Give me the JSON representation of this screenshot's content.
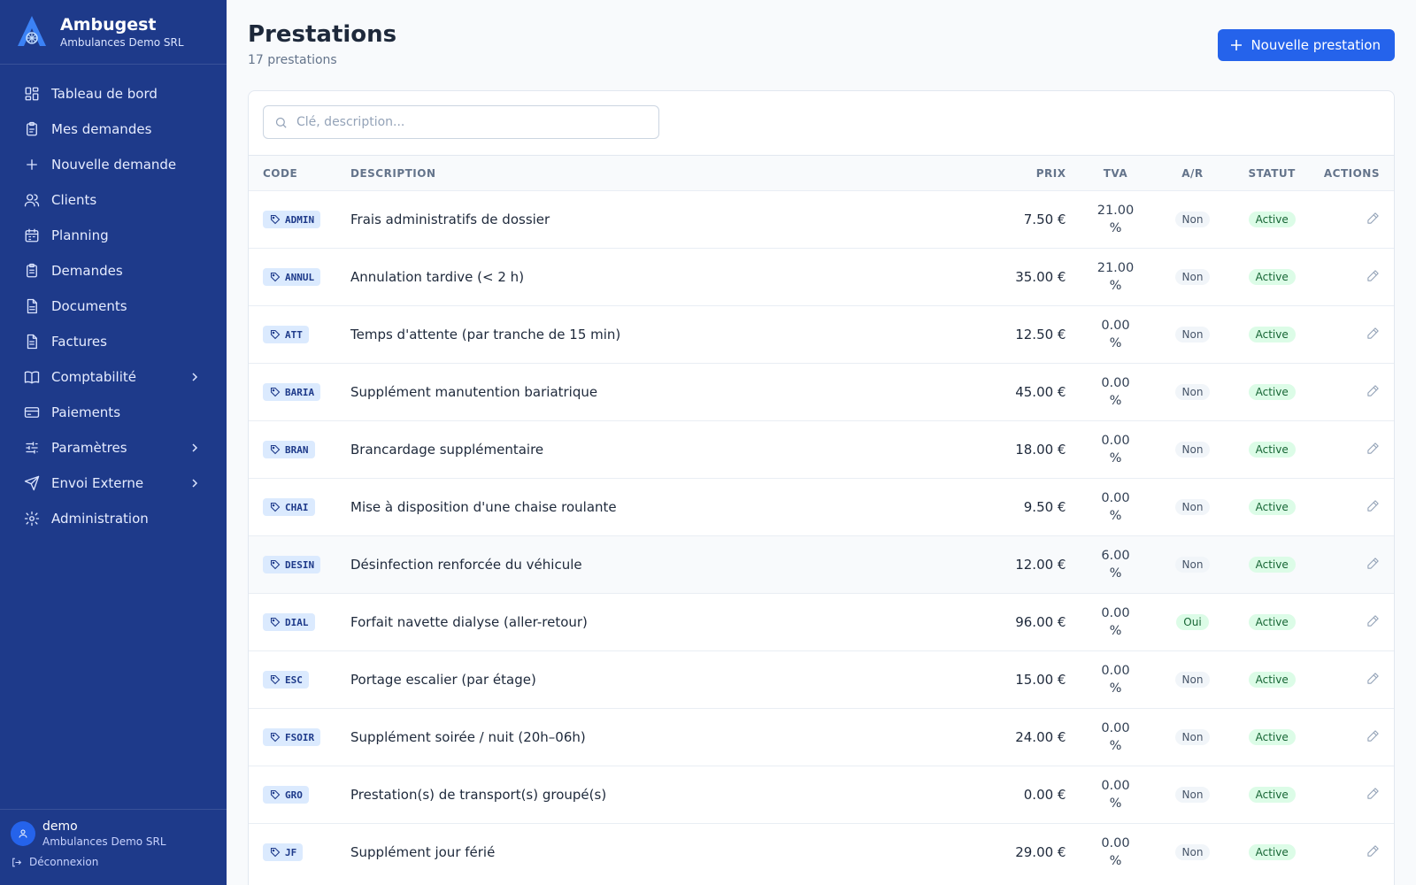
{
  "brand": {
    "name": "Ambugest",
    "subtitle": "Ambulances Demo SRL"
  },
  "nav": [
    {
      "label": "Tableau de bord",
      "icon": "dashboard-icon",
      "chevron": false
    },
    {
      "label": "Mes demandes",
      "icon": "clipboard-icon",
      "chevron": false
    },
    {
      "label": "Nouvelle demande",
      "icon": "plus-icon",
      "chevron": false
    },
    {
      "label": "Clients",
      "icon": "users-icon",
      "chevron": false
    },
    {
      "label": "Planning",
      "icon": "calendar-icon",
      "chevron": false
    },
    {
      "label": "Demandes",
      "icon": "clipboard-list-icon",
      "chevron": false
    },
    {
      "label": "Documents",
      "icon": "file-icon",
      "chevron": false
    },
    {
      "label": "Factures",
      "icon": "invoice-icon",
      "chevron": false
    },
    {
      "label": "Comptabilité",
      "icon": "book-icon",
      "chevron": true
    },
    {
      "label": "Paiements",
      "icon": "credit-card-icon",
      "chevron": false
    },
    {
      "label": "Paramètres",
      "icon": "sliders-icon",
      "chevron": true
    },
    {
      "label": "Envoi Externe",
      "icon": "send-icon",
      "chevron": true
    },
    {
      "label": "Administration",
      "icon": "gear-icon",
      "chevron": false
    }
  ],
  "user": {
    "name": "demo",
    "org": "Ambulances Demo SRL",
    "logout_label": "Déconnexion"
  },
  "page": {
    "title": "Prestations",
    "count": "17 prestations",
    "new_button": "Nouvelle prestation"
  },
  "search": {
    "placeholder": "Clé, description..."
  },
  "table": {
    "columns": {
      "code": "Code",
      "description": "Description",
      "prix": "Prix",
      "tva": "TVA",
      "ar": "A/R",
      "statut": "Statut",
      "actions": "Actions"
    },
    "rows": [
      {
        "code": "ADMIN",
        "description": "Frais administratifs de dossier",
        "prix": "7.50 €",
        "tva_value": "21.00",
        "tva_unit": "%",
        "ar": "Non",
        "statut": "Active"
      },
      {
        "code": "ANNUL",
        "description": "Annulation tardive (< 2 h)",
        "prix": "35.00 €",
        "tva_value": "21.00",
        "tva_unit": "%",
        "ar": "Non",
        "statut": "Active"
      },
      {
        "code": "ATT",
        "description": "Temps d'attente (par tranche de 15 min)",
        "prix": "12.50 €",
        "tva_value": "0.00",
        "tva_unit": "%",
        "ar": "Non",
        "statut": "Active"
      },
      {
        "code": "BARIA",
        "description": "Supplément manutention bariatrique",
        "prix": "45.00 €",
        "tva_value": "0.00",
        "tva_unit": "%",
        "ar": "Non",
        "statut": "Active"
      },
      {
        "code": "BRAN",
        "description": "Brancardage supplémentaire",
        "prix": "18.00 €",
        "tva_value": "0.00",
        "tva_unit": "%",
        "ar": "Non",
        "statut": "Active"
      },
      {
        "code": "CHAI",
        "description": "Mise à disposition d'une chaise roulante",
        "prix": "9.50 €",
        "tva_value": "0.00",
        "tva_unit": "%",
        "ar": "Non",
        "statut": "Active"
      },
      {
        "code": "DESIN",
        "description": "Désinfection renforcée du véhicule",
        "prix": "12.00 €",
        "tva_value": "6.00",
        "tva_unit": "%",
        "ar": "Non",
        "statut": "Active"
      },
      {
        "code": "DIAL",
        "description": "Forfait navette dialyse (aller-retour)",
        "prix": "96.00 €",
        "tva_value": "0.00",
        "tva_unit": "%",
        "ar": "Oui",
        "statut": "Active"
      },
      {
        "code": "ESC",
        "description": "Portage escalier (par étage)",
        "prix": "15.00 €",
        "tva_value": "0.00",
        "tva_unit": "%",
        "ar": "Non",
        "statut": "Active"
      },
      {
        "code": "FSOIR",
        "description": "Supplément soirée / nuit (20h–06h)",
        "prix": "24.00 €",
        "tva_value": "0.00",
        "tva_unit": "%",
        "ar": "Non",
        "statut": "Active"
      },
      {
        "code": "GRO",
        "description": "Prestation(s) de transport(s) groupé(s)",
        "prix": "0.00 €",
        "tva_value": "0.00",
        "tva_unit": "%",
        "ar": "Non",
        "statut": "Active"
      },
      {
        "code": "JF",
        "description": "Supplément jour férié",
        "prix": "29.00 €",
        "tva_value": "0.00",
        "tva_unit": "%",
        "ar": "Non",
        "statut": "Active"
      }
    ]
  },
  "colors": {
    "sidebar": "#1e3a8a",
    "primary": "#2563eb",
    "badge_bg": "#dbeafe",
    "active_bg": "#dcfce7",
    "active_text": "#166534"
  }
}
